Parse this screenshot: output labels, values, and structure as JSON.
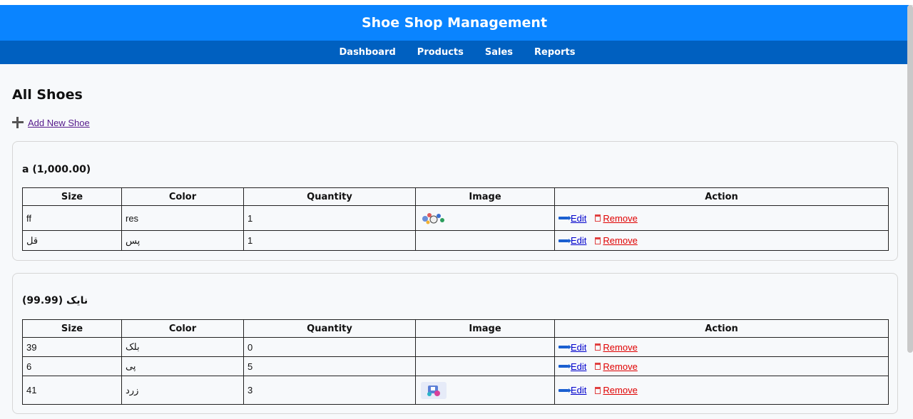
{
  "header": {
    "title": "Shoe Shop Management"
  },
  "nav": {
    "items": [
      "Dashboard",
      "Products",
      "Sales",
      "Reports"
    ]
  },
  "page": {
    "title": "All Shoes",
    "add_label": "Add New Shoe"
  },
  "columns": [
    "Size",
    "Color",
    "Quantity",
    "Image",
    "Action"
  ],
  "actions": {
    "edit": "Edit",
    "remove": "Remove"
  },
  "shoes": [
    {
      "title": "a (1,000.00)",
      "rows": [
        {
          "size": "ff",
          "color": "res",
          "quantity": "1",
          "image": "shoe-thumbnail"
        },
        {
          "size": "قل",
          "color": "پس",
          "quantity": "1",
          "image": ""
        }
      ]
    },
    {
      "title": "نایک (99.99)",
      "rows": [
        {
          "size": "39",
          "color": "بلک",
          "quantity": "0",
          "image": ""
        },
        {
          "size": "6",
          "color": "پی",
          "quantity": "5",
          "image": ""
        },
        {
          "size": "41",
          "color": "زرد",
          "quantity": "3",
          "image": "shoe-thumbnail"
        }
      ]
    }
  ]
}
